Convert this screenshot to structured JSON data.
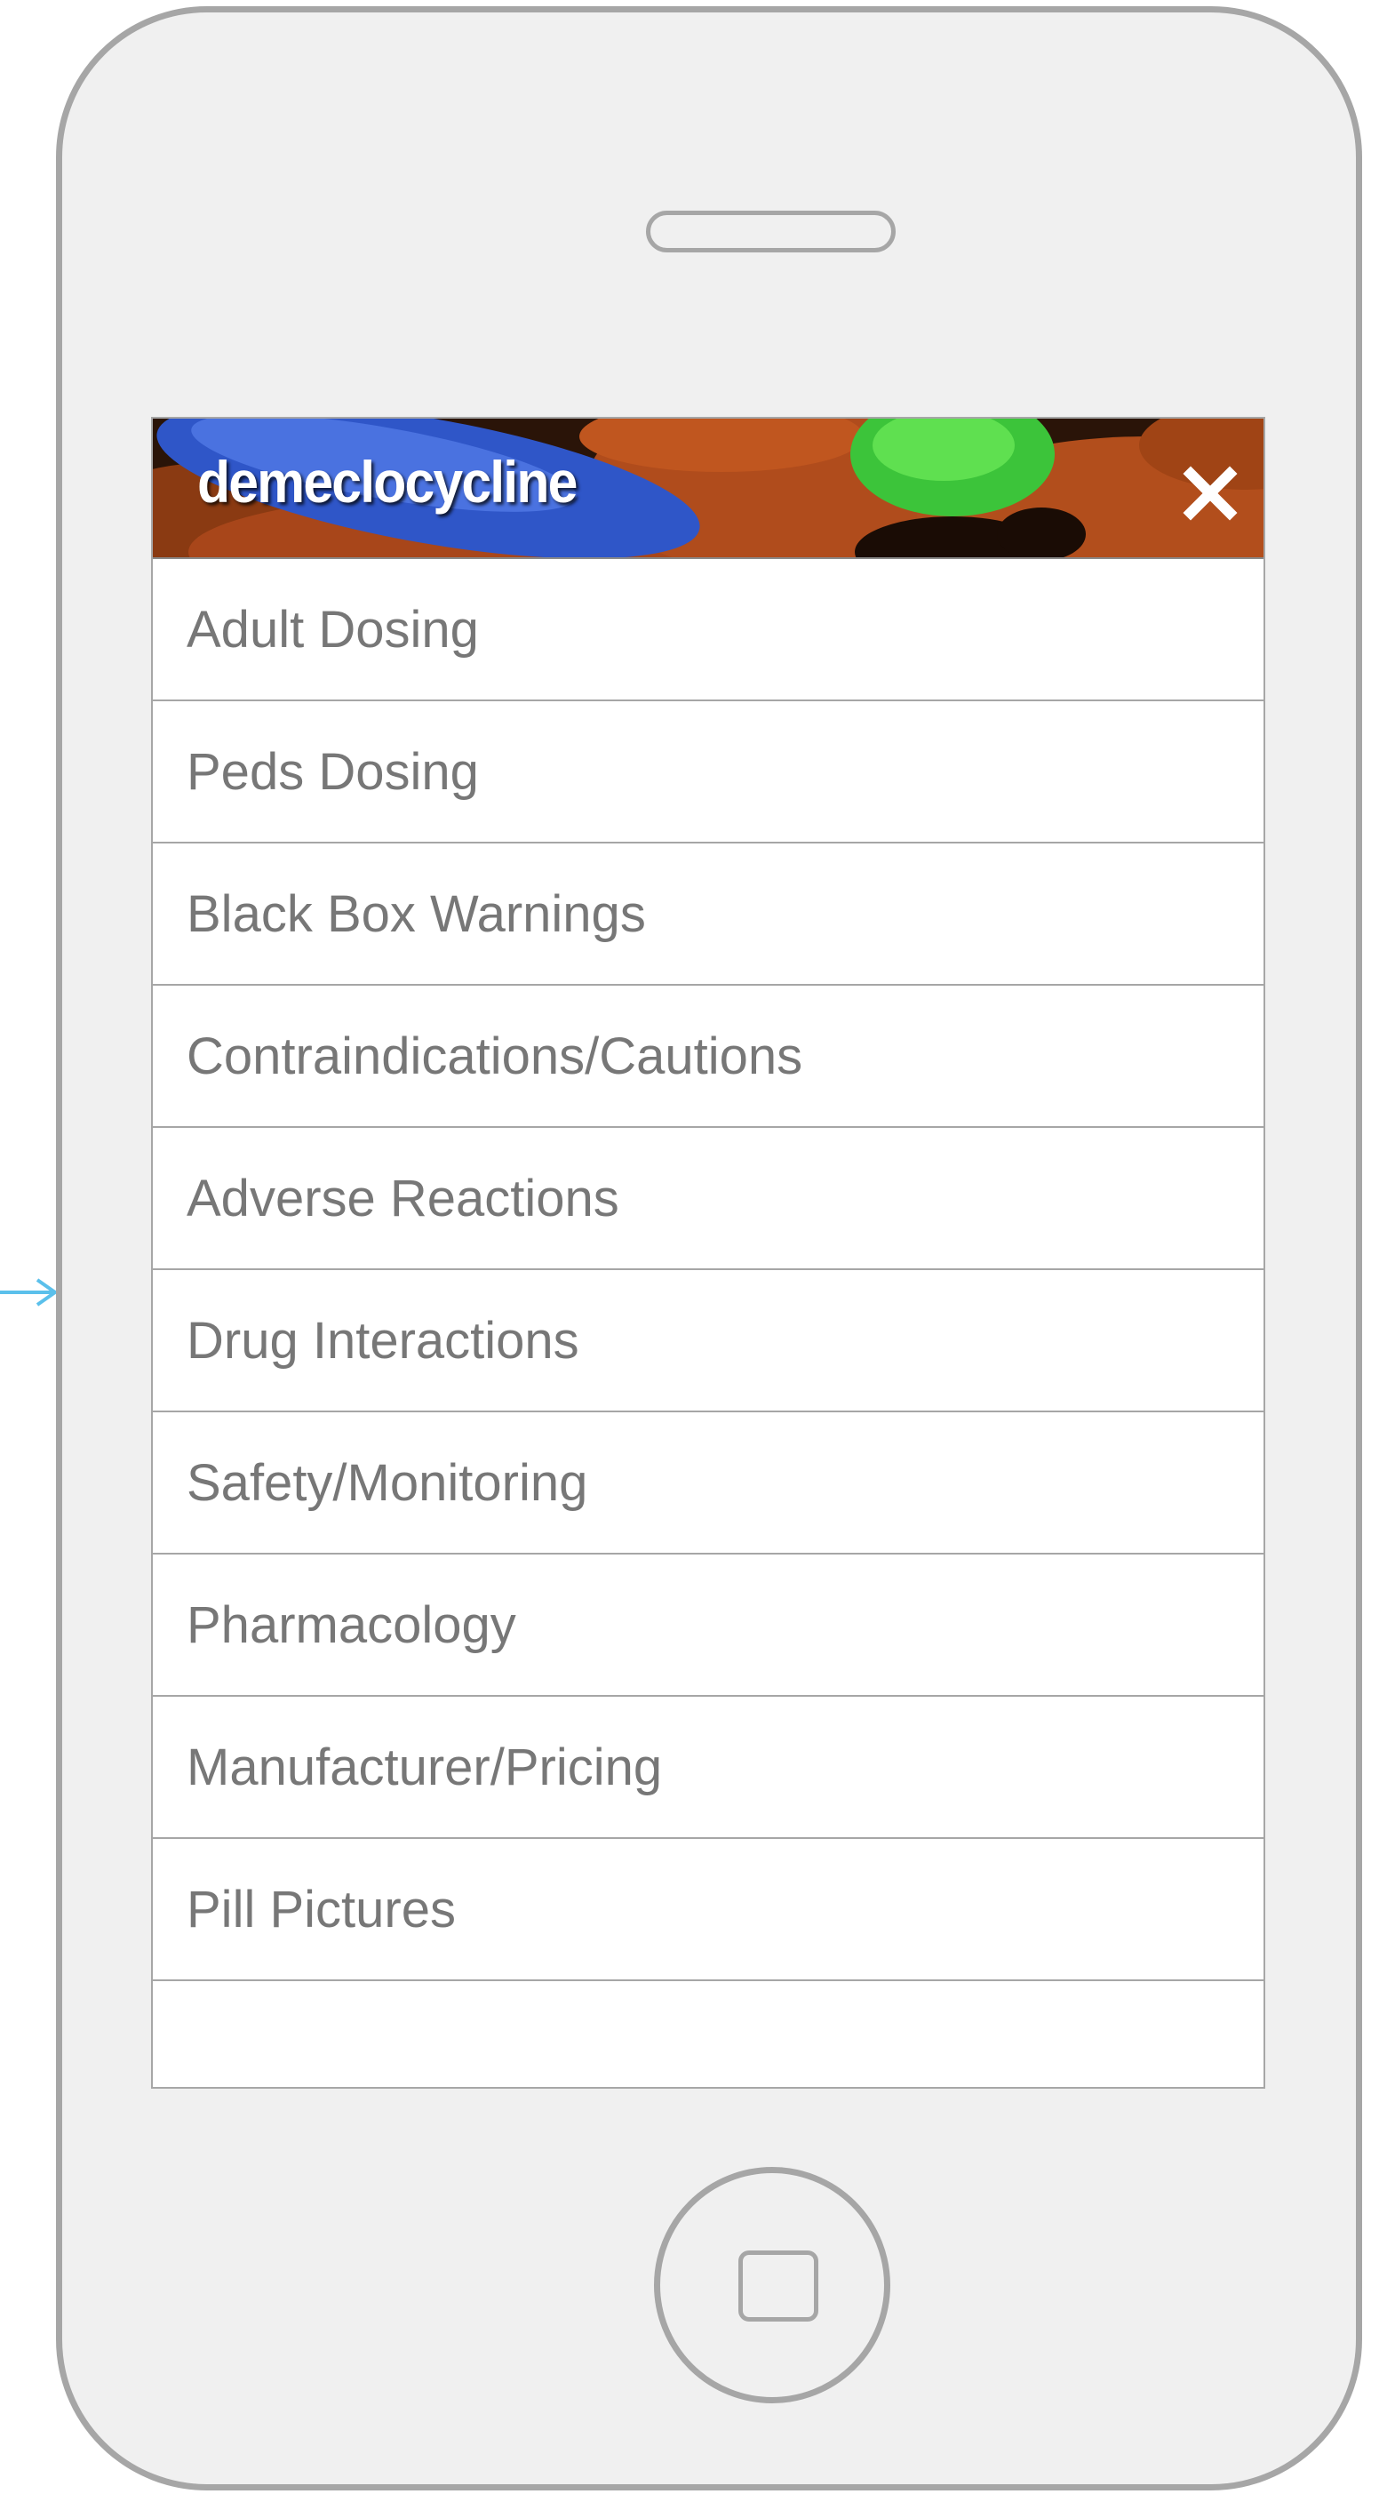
{
  "header": {
    "drug_name": "demeclocycline",
    "close_icon": "close-icon"
  },
  "menu": {
    "items": [
      {
        "label": "Adult Dosing"
      },
      {
        "label": "Peds Dosing"
      },
      {
        "label": "Black Box Warnings"
      },
      {
        "label": "Contraindications/Cautions"
      },
      {
        "label": "Adverse Reactions"
      },
      {
        "label": "Drug Interactions"
      },
      {
        "label": "Safety/Monitoring"
      },
      {
        "label": "Pharmacology"
      },
      {
        "label": "Manufacturer/Pricing"
      },
      {
        "label": "Pill Pictures"
      }
    ]
  },
  "colors": {
    "phone_frame": "#a6a6a6",
    "phone_body": "#f0f0f0",
    "menu_text": "#777777",
    "connector_arrow": "#5bc0eb"
  }
}
